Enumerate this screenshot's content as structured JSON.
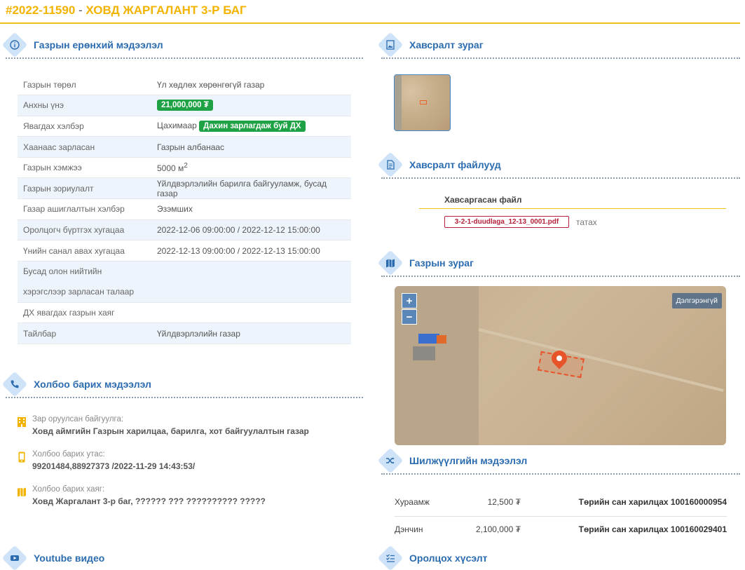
{
  "header": {
    "id": "#2022-11590",
    "dash": " - ",
    "title": "ХОВД ЖАРГАЛАНТ 3-Р БАГ"
  },
  "sections": {
    "general": "Газрын ерөнхий мэдээлэл",
    "contact": "Холбоо барих мэдээлэл",
    "youtube": "Youtube видео",
    "image": "Хавсралт зураг",
    "files": "Хавсралт файлууд",
    "map": "Газрын зураг",
    "transfer": "Шилжүүлгийн мэдээлэл",
    "request": "Оролцох хүсэлт"
  },
  "general_info": [
    {
      "key": "Газрын төрөл",
      "value": "Үл хөдлөх хөрөнгөгүй газар"
    },
    {
      "key": "Анхны үнэ",
      "badge": "21,000,000 ₮"
    },
    {
      "key": "Явагдах хэлбэр",
      "value": "Цахимаар",
      "badge": "Дахин зарлагдаж буй ДХ"
    },
    {
      "key": "Хаанаас зарласан",
      "value": "Газрын албанаас"
    },
    {
      "key": "Газрын хэмжээ",
      "value": "5000 м",
      "sup": "2"
    },
    {
      "key": "Газрын зориулалт",
      "value": "Үйлдвэрлэлийн барилга байгууламж, бусад газар"
    },
    {
      "key": "Газар ашиглалтын хэлбэр",
      "value": "Эзэмших"
    },
    {
      "key": "Оролцогч бүртгэх хугацаа",
      "value": "2022-12-06 09:00:00 / 2022-12-12 15:00:00"
    },
    {
      "key": "Үнийн санал авах хугацаа",
      "value": "2022-12-13 09:00:00 / 2022-12-13 15:00:00"
    },
    {
      "key": "Бусад олон нийтийн хэрэгслээр зарласан талаар",
      "value": ""
    },
    {
      "key": "ДХ явагдах газрын хаяг",
      "value": ""
    },
    {
      "key": "Тайлбар",
      "value": "Үйлдвэрлэлийн газар"
    }
  ],
  "contact": {
    "org_label": "Зар оруулсан байгуулга:",
    "org_value": "Ховд аймгийн Газрын харилцаа, барилга, хот байгуулалтын газар",
    "phone_label": "Холбоо барих утас:",
    "phone_value": "99201484,88927373 /2022-11-29 14:43:53/",
    "address_label": "Холбоо барих хаяг:",
    "address_value": "Ховд Жаргалант 3-р баг, ?????? ??? ?????????? ?????"
  },
  "files": {
    "header": "Хавсаргасан файл",
    "name": "3-2-1-duudlaga_12-13_0001.pdf",
    "download": "татах"
  },
  "map": {
    "zoom_in": "+",
    "zoom_out": "−",
    "detail": "Дэлгэрэнгүй"
  },
  "transfer": [
    {
      "name": "Хураамж",
      "amount": "12,500 ₮",
      "account": "Төрийн сан харилцах 100160000954"
    },
    {
      "name": "Дэнчин",
      "amount": "2,100,000 ₮",
      "account": "Төрийн сан харилцах 100160029401"
    }
  ],
  "colors": {
    "accent": "#f2b400",
    "heading_blue": "#2b6cb0",
    "badge_green": "#1fa145"
  }
}
